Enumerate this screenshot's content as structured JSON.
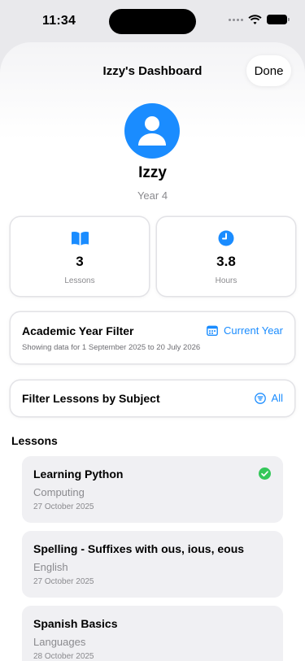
{
  "status": {
    "time": "11:34"
  },
  "nav": {
    "title": "Izzy's Dashboard",
    "done_label": "Done"
  },
  "student": {
    "name": "Izzy",
    "year": "Year 4"
  },
  "stats": [
    {
      "value": "3",
      "label": "Lessons",
      "icon": "book-icon"
    },
    {
      "value": "3.8",
      "label": "Hours",
      "icon": "clock-icon"
    }
  ],
  "academic_filter": {
    "title": "Academic Year Filter",
    "action_label": "Current Year",
    "subtitle": "Showing data for 1 September 2025 to 20 July 2026",
    "icon": "calendar-icon"
  },
  "subject_filter": {
    "title": "Filter Lessons by Subject",
    "action_label": "All",
    "icon": "filter-icon"
  },
  "lessons_section": {
    "title": "Lessons"
  },
  "lessons": [
    {
      "title": "Learning Python",
      "subject": "Computing",
      "date": "27 October 2025",
      "completed": true
    },
    {
      "title": "Spelling - Suffixes with ous, ious, eous",
      "subject": "English",
      "date": "27 October 2025",
      "completed": false
    },
    {
      "title": "Spanish Basics",
      "subject": "Languages",
      "date": "28 October 2025",
      "completed": false
    }
  ],
  "colors": {
    "accent": "#1a8cff",
    "success": "#34c759",
    "secondary_text": "#8a8a8e"
  }
}
